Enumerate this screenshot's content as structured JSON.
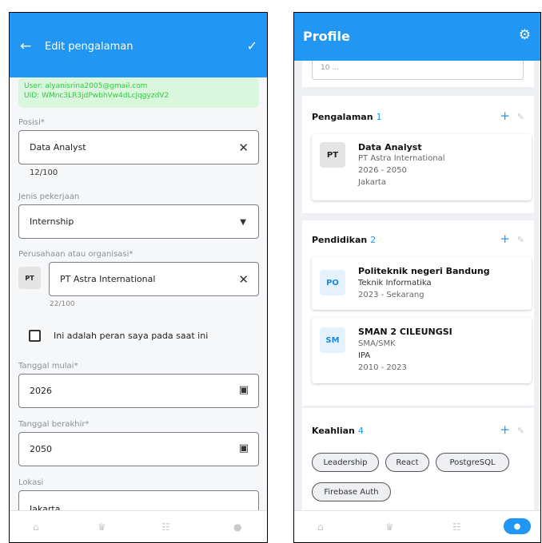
{
  "left": {
    "title": "Edit pengalaman",
    "info": {
      "user": "User: alyanisrina2005@gmail.com",
      "uid": "UID: WMnc3LR3jdPwbhVw4dLcJqgyzdV2"
    },
    "posisi": {
      "label": "Posisi*",
      "value": "Data Analyst",
      "counter": "12/100"
    },
    "jenis": {
      "label": "Jenis pekerjaan",
      "value": "Internship"
    },
    "perusahaan": {
      "label": "Perusahaan atau organisasi*",
      "badge": "PT",
      "value": "PT Astra International",
      "counter": "22/100"
    },
    "current_role_label": "Ini adalah peran saya pada saat ini",
    "mulai": {
      "label": "Tanggal mulai*",
      "value": "2026"
    },
    "berakhir": {
      "label": "Tanggal berakhir*",
      "value": "2050"
    },
    "lokasi": {
      "label": "Lokasi",
      "value": "Jakarta"
    }
  },
  "right": {
    "title": "Profile",
    "top_snippet": "10 ...",
    "pengalaman": {
      "title": "Pengalaman",
      "count": "1",
      "items": [
        {
          "badge": "PT",
          "title": "Data Analyst",
          "company": "PT Astra International",
          "period": "2026 - 2050",
          "location": "Jakarta"
        }
      ]
    },
    "pendidikan": {
      "title": "Pendidikan",
      "count": "2",
      "items": [
        {
          "badge": "PO",
          "title": "Politeknik negeri Bandung",
          "line1": "Teknik Informatika",
          "line2": "2023 - Sekarang"
        },
        {
          "badge": "SM",
          "title": "SMAN 2 CILEUNGSI",
          "line1": "SMA/SMK",
          "line2": "IPA",
          "line3": "2010 - 2023"
        }
      ]
    },
    "keahlian": {
      "title": "Keahlian",
      "count": "4",
      "chips": [
        "Leadership",
        "React",
        "PostgreSQL",
        "Firebase Auth"
      ]
    }
  },
  "colors": {
    "primary": "#2196f3",
    "info_bg": "#d9f7dc",
    "info_text": "#2ecc40"
  },
  "icons": [
    "back-arrow-icon",
    "check-icon",
    "clear-icon",
    "dropdown-icon",
    "calendar-icon",
    "gear-icon",
    "plus-icon",
    "pencil-icon",
    "home-icon",
    "trophy-icon",
    "people-icon",
    "person-icon"
  ]
}
